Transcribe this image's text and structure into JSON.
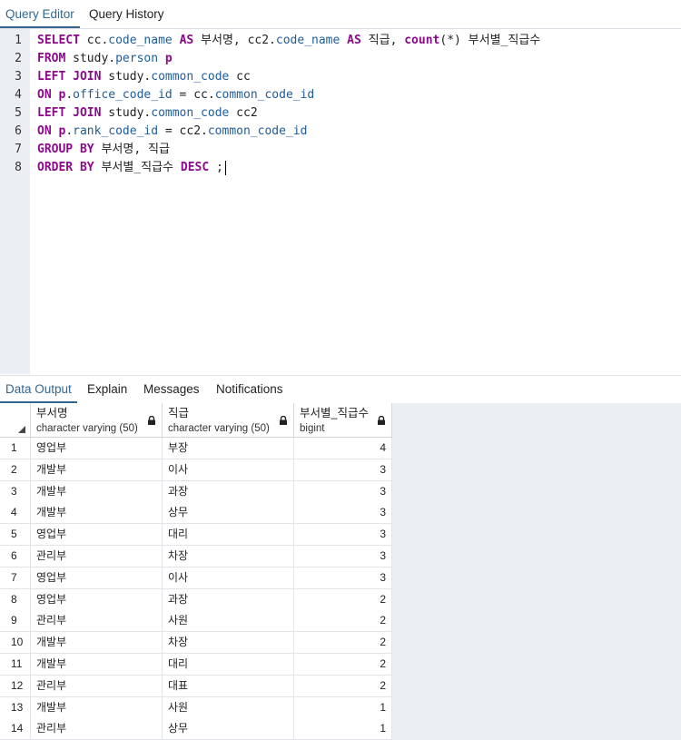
{
  "top_tabs": [
    {
      "label": "Query Editor",
      "active": true
    },
    {
      "label": "Query History",
      "active": false
    }
  ],
  "editor": {
    "line_numbers": [
      "1",
      "2",
      "3",
      "4",
      "5",
      "6",
      "7",
      "8"
    ]
  },
  "result_tabs": [
    {
      "label": "Data Output",
      "active": true
    },
    {
      "label": "Explain",
      "active": false
    },
    {
      "label": "Messages",
      "active": false
    },
    {
      "label": "Notifications",
      "active": false
    }
  ],
  "grid": {
    "columns": [
      {
        "name": "부서명",
        "type": "character varying (50)"
      },
      {
        "name": "직급",
        "type": "character varying (50)"
      },
      {
        "name": "부서별_직급수",
        "type": "bigint"
      }
    ],
    "rows": [
      [
        "1",
        "영업부",
        "부장",
        "4"
      ],
      [
        "2",
        "개발부",
        "이사",
        "3"
      ],
      [
        "3",
        "개발부",
        "과장",
        "3"
      ],
      [
        "4",
        "개발부",
        "상무",
        "3"
      ],
      [
        "5",
        "영업부",
        "대리",
        "3"
      ],
      [
        "6",
        "관리부",
        "차장",
        "3"
      ],
      [
        "7",
        "영업부",
        "이사",
        "3"
      ],
      [
        "8",
        "영업부",
        "과장",
        "2"
      ],
      [
        "9",
        "관리부",
        "사원",
        "2"
      ],
      [
        "10",
        "개발부",
        "차장",
        "2"
      ],
      [
        "11",
        "개발부",
        "대리",
        "2"
      ],
      [
        "12",
        "관리부",
        "대표",
        "2"
      ],
      [
        "13",
        "개발부",
        "사원",
        "1"
      ],
      [
        "14",
        "관리부",
        "상무",
        "1"
      ]
    ]
  },
  "colors": {
    "accent": "#326690",
    "keyword": "#8b0a8b",
    "identifier": "#1f5c99",
    "gutter": "#ebeef3"
  }
}
